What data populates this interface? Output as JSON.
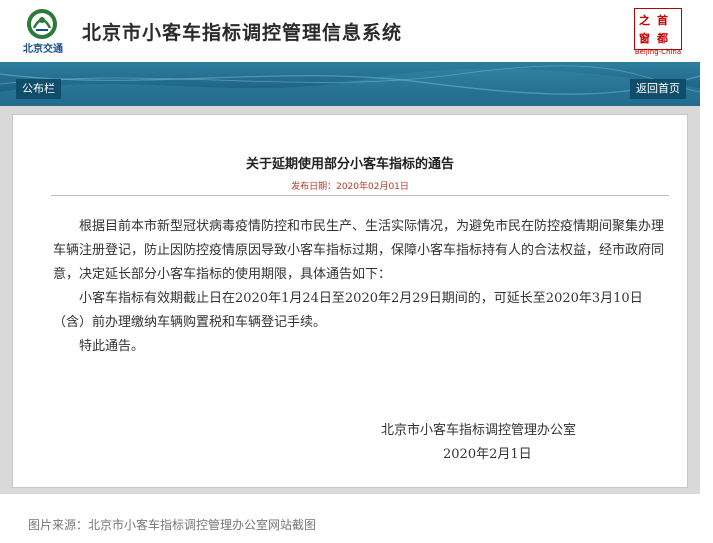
{
  "header": {
    "logo_text": "北京交通",
    "site_title": "北京市小客车指标调控管理信息系统",
    "badge_chars": [
      "之",
      "首",
      "窗",
      "都"
    ],
    "badge_caption": "Beijing-China"
  },
  "nav": {
    "left_label": "公布栏",
    "right_label": "返回首页"
  },
  "notice": {
    "title": "关于延期使用部分小客车指标的通告",
    "date_label": "发布日期：2020年02月01日",
    "paragraphs": [
      "根据目前本市新型冠状病毒疫情防控和市民生产、生活实际情况，为避免市民在防控疫情期间聚集办理车辆注册登记，防止因防控疫情原因导致小客车指标过期，保障小客车指标持有人的合法权益，经市政府同意，决定延长部分小客车指标的使用期限，具体通告如下：",
      "小客车指标有效期截止日在2020年1月24日至2020年2月29日期间的，可延长至2020年3月10日（含）前办理缴纳车辆购置税和车辆登记手续。",
      "特此通告。"
    ],
    "signature_org": "北京市小客车指标调控管理办公室",
    "signature_date": "2020年2月1日"
  },
  "caption": "图片来源：北京市小客车指标调控管理办公室网站截图",
  "colors": {
    "nav_bar": "#1f6787",
    "nav_button": "#0f4d6b",
    "date_red": "#b23a2e",
    "badge_red": "#c80000"
  }
}
